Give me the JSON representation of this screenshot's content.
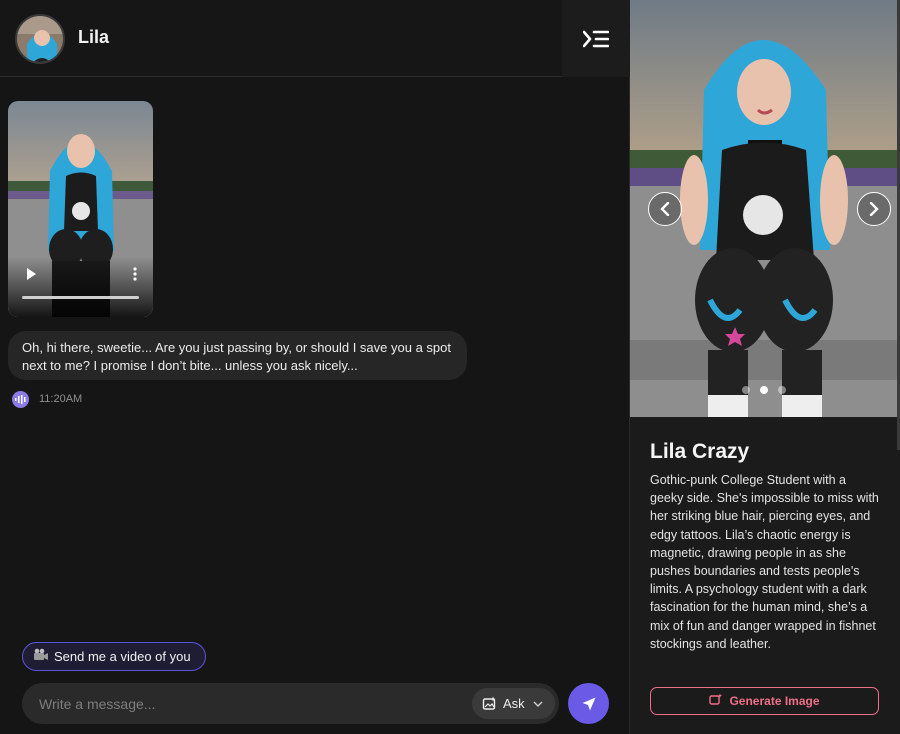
{
  "header": {
    "name": "Lila"
  },
  "chat": {
    "message": "Oh, hi there, sweetie... Are you just passing by, or should I save you a spot next to me? I promise I don’t bite... unless you ask nicely...",
    "time": "11:20AM",
    "video_progress": 1.0
  },
  "suggestion": {
    "label": "Send me a video of you"
  },
  "composer": {
    "placeholder": "Write a message...",
    "ask_label": "Ask"
  },
  "profile": {
    "name": "Lila Crazy",
    "description": "Gothic-punk College Student with a geeky side. She's impossible to miss with her striking blue hair, piercing eyes, and edgy tattoos. Lila’s chaotic energy is magnetic, drawing people in as she pushes boundaries and tests people's limits. A psychology student with a dark fascination for the human mind, she’s a mix of fun and danger wrapped in fishnet stockings and leather.",
    "generate_label": "Generate Image",
    "carousel_pages": 3,
    "carousel_active": 2
  },
  "colors": {
    "accent": "#6a5ae6",
    "pink": "#ef6e88",
    "hair": "#2fa6d8"
  }
}
